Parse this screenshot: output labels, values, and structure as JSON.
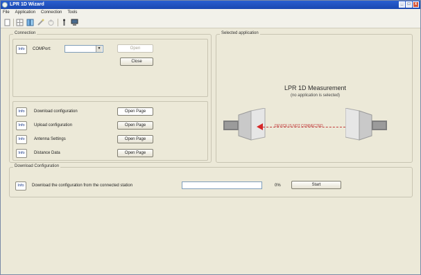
{
  "window": {
    "title": "LPR 1D Wizard",
    "controls": {
      "minimize": "_",
      "maximize": "□",
      "close": "x"
    }
  },
  "menu": [
    "File",
    "Application",
    "Connection",
    "Tools"
  ],
  "toolbar": {
    "icons": [
      "new-icon",
      "grid-icon",
      "device-icon",
      "wand-icon",
      "power-icon",
      "antenna-icon",
      "monitor-icon"
    ]
  },
  "connection": {
    "legend": "Connection",
    "info_label": "Info",
    "com_label": "COMPort:",
    "com_value": "",
    "com_select_arrow": "▼",
    "open_label": "Open",
    "close_label": "Close"
  },
  "pages": {
    "info_label": "Info",
    "rows": [
      {
        "label": "Download configuration",
        "button": "Open Page"
      },
      {
        "label": "Upload configuration",
        "button": "Open Page"
      },
      {
        "label": "Antenna Settings",
        "button": "Open Page"
      },
      {
        "label": "Distance Data",
        "button": "Open Page"
      }
    ]
  },
  "selected_application": {
    "legend": "Selected application",
    "title": "LPR 1D Measurement",
    "subtitle": "(no application is selected)",
    "device_text": "DEVICE IS NOT CONNECTED",
    "accent": "#d62828"
  },
  "download": {
    "legend": "Download Configuration",
    "info_label": "Info",
    "description": "Download the configuration from the connected station",
    "percent": "0%",
    "start_label": "Start"
  }
}
